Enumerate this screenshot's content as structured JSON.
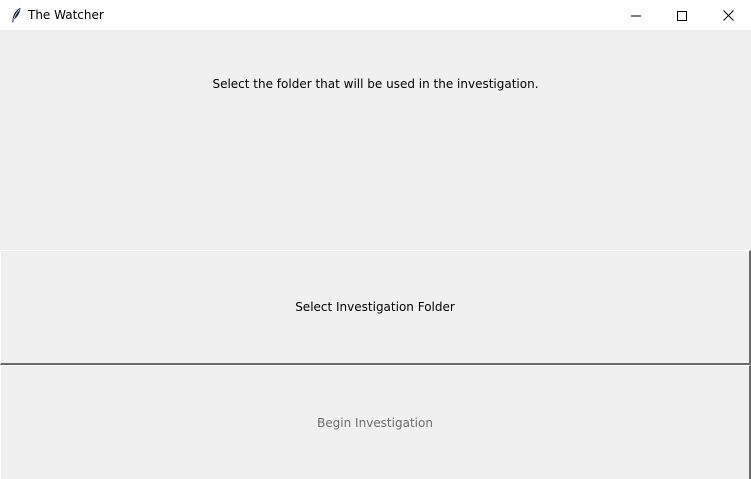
{
  "window": {
    "title": "The Watcher",
    "app_icon": "feather-icon",
    "controls": [
      "minimize-icon",
      "maximize-icon",
      "close-icon"
    ]
  },
  "main": {
    "instruction": "Select the folder that will be used in the investigation.",
    "select_button_label": "Select Investigation Folder",
    "begin_button_label": "Begin Investigation",
    "begin_button_disabled": true
  },
  "colors": {
    "background": "#f0f0f0",
    "titlebar": "#ffffff",
    "disabled_text": "#6d6d6d"
  }
}
